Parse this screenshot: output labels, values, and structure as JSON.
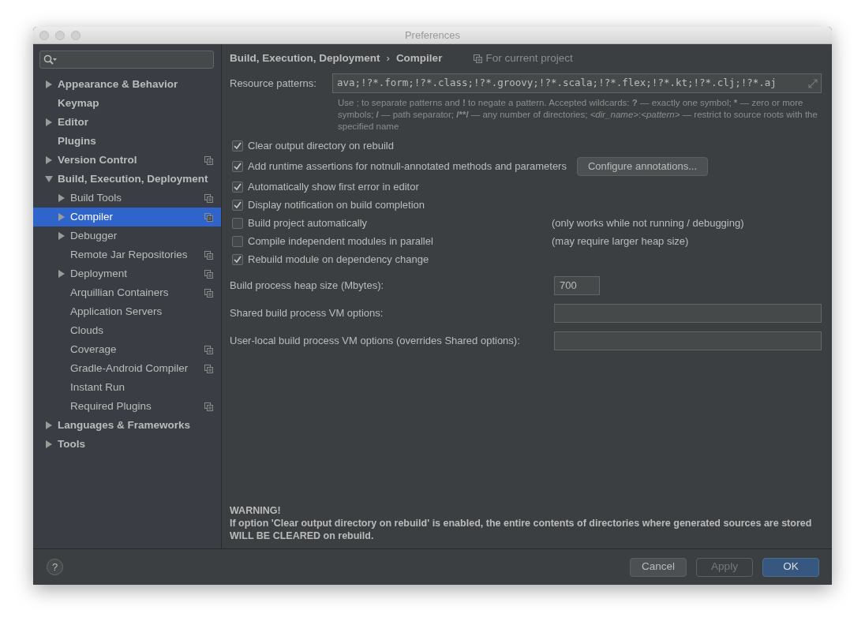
{
  "window": {
    "title": "Preferences"
  },
  "sidebar": {
    "items": [
      {
        "label": "Appearance & Behavior",
        "expandable": true,
        "expanded": false,
        "selected": false,
        "project_scoped": false
      },
      {
        "label": "Keymap",
        "expandable": false,
        "selected": false,
        "project_scoped": false
      },
      {
        "label": "Editor",
        "expandable": true,
        "expanded": false,
        "selected": false,
        "project_scoped": false
      },
      {
        "label": "Plugins",
        "expandable": false,
        "selected": false,
        "project_scoped": false
      },
      {
        "label": "Version Control",
        "expandable": true,
        "expanded": false,
        "selected": false,
        "project_scoped": true
      },
      {
        "label": "Build, Execution, Deployment",
        "expandable": true,
        "expanded": true,
        "selected": false,
        "project_scoped": false,
        "children": [
          {
            "label": "Build Tools",
            "expandable": true,
            "expanded": false,
            "selected": false,
            "project_scoped": true
          },
          {
            "label": "Compiler",
            "expandable": true,
            "expanded": false,
            "selected": true,
            "project_scoped": true
          },
          {
            "label": "Debugger",
            "expandable": true,
            "expanded": false,
            "selected": false,
            "project_scoped": false
          },
          {
            "label": "Remote Jar Repositories",
            "expandable": false,
            "selected": false,
            "project_scoped": true
          },
          {
            "label": "Deployment",
            "expandable": true,
            "expanded": false,
            "selected": false,
            "project_scoped": true
          },
          {
            "label": "Arquillian Containers",
            "expandable": false,
            "selected": false,
            "project_scoped": true
          },
          {
            "label": "Application Servers",
            "expandable": false,
            "selected": false,
            "project_scoped": false
          },
          {
            "label": "Clouds",
            "expandable": false,
            "selected": false,
            "project_scoped": false
          },
          {
            "label": "Coverage",
            "expandable": false,
            "selected": false,
            "project_scoped": true
          },
          {
            "label": "Gradle-Android Compiler",
            "expandable": false,
            "selected": false,
            "project_scoped": true
          },
          {
            "label": "Instant Run",
            "expandable": false,
            "selected": false,
            "project_scoped": false
          },
          {
            "label": "Required Plugins",
            "expandable": false,
            "selected": false,
            "project_scoped": true
          }
        ]
      },
      {
        "label": "Languages & Frameworks",
        "expandable": true,
        "expanded": false,
        "selected": false,
        "project_scoped": false
      },
      {
        "label": "Tools",
        "expandable": true,
        "expanded": false,
        "selected": false,
        "project_scoped": false
      }
    ]
  },
  "breadcrumb": {
    "parent": "Build, Execution, Deployment",
    "separator": "›",
    "current": "Compiler",
    "scope": "For current project"
  },
  "resource_patterns": {
    "label": "Resource patterns:",
    "value": "ava;!?*.form;!?*.class;!?*.groovy;!?*.scala;!?*.flex;!?*.kt;!?*.clj;!?*.aj",
    "hint": [
      {
        "text": "Use ; to separate patterns and ",
        "kind": "text"
      },
      {
        "text": "!",
        "kind": "symbol"
      },
      {
        "text": " to negate a pattern. Accepted wildcards: ",
        "kind": "text"
      },
      {
        "text": "?",
        "kind": "symbol"
      },
      {
        "text": " — exactly one symbol; ",
        "kind": "text"
      },
      {
        "text": "*",
        "kind": "symbol"
      },
      {
        "text": " — zero or more symbols; ",
        "kind": "text"
      },
      {
        "text": "/",
        "kind": "symbol"
      },
      {
        "text": " — path separator; ",
        "kind": "text"
      },
      {
        "text": "/**/",
        "kind": "symbol"
      },
      {
        "text": " — any number of directories; ",
        "kind": "text"
      },
      {
        "text": "<dir_name>",
        "kind": "variable"
      },
      {
        "text": ":",
        "kind": "text"
      },
      {
        "text": "<pattern>",
        "kind": "variable"
      },
      {
        "text": " — restrict to source roots with the specified name",
        "kind": "text"
      }
    ]
  },
  "options": [
    {
      "label": "Clear output directory on rebuild",
      "checked": true
    },
    {
      "label": "Add runtime assertions for notnull-annotated methods and parameters",
      "checked": true,
      "button": "Configure annotations..."
    },
    {
      "label": "Automatically show first error in editor",
      "checked": true
    },
    {
      "label": "Display notification on build completion",
      "checked": true
    },
    {
      "label": "Build project automatically",
      "checked": false,
      "note": "(only works while not running / debugging)"
    },
    {
      "label": "Compile independent modules in parallel",
      "checked": false,
      "note": "(may require larger heap size)"
    },
    {
      "label": "Rebuild module on dependency change",
      "checked": true
    }
  ],
  "fields": [
    {
      "label": "Build process heap size (Mbytes):",
      "value": "700",
      "kind": "short"
    },
    {
      "label": "Shared build process VM options:",
      "kind": "wide"
    },
    {
      "label": "User-local build process VM options (overrides Shared options):",
      "kind": "wide"
    }
  ],
  "warning": {
    "title": "WARNING!",
    "text": "If option 'Clear output directory on rebuild' is enabled, the entire contents of directories where generated sources are stored WILL BE CLEARED on rebuild."
  },
  "footer": {
    "help": "?",
    "buttons": [
      {
        "label": "Cancel",
        "kind": "normal",
        "disabled": false
      },
      {
        "label": "Apply",
        "kind": "normal",
        "disabled": true
      },
      {
        "label": "OK",
        "kind": "default",
        "disabled": false
      }
    ]
  }
}
